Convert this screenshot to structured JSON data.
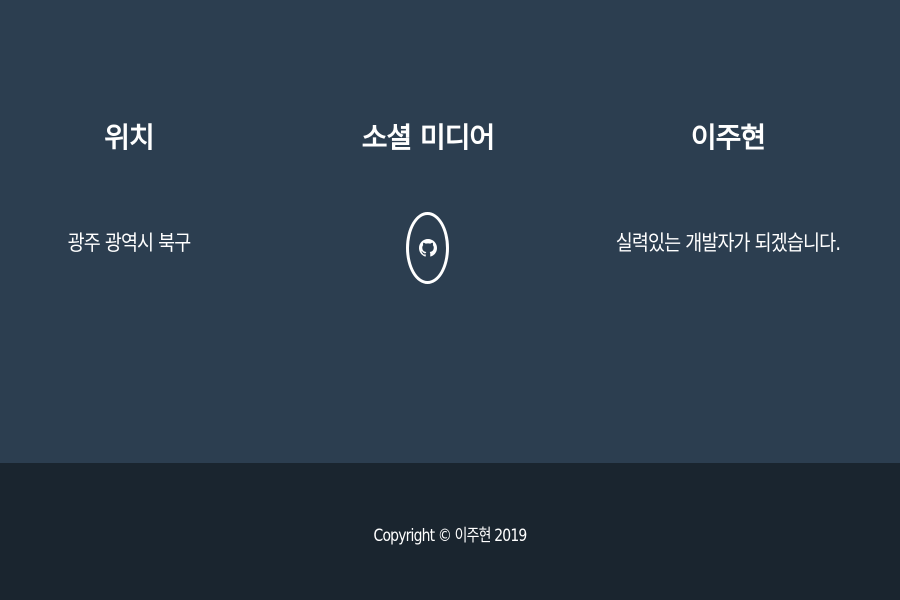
{
  "sections": {
    "location": {
      "heading": "위치",
      "text": "광주 광역시 북구"
    },
    "social": {
      "heading": "소셜 미디어",
      "icons": [
        "github-icon"
      ]
    },
    "about": {
      "heading": "이주현",
      "text": "실력있는 개발자가 되겠습니다."
    }
  },
  "copyright": {
    "text": "Copyright © 이주현 2019"
  },
  "colors": {
    "footer_bg": "#2c3e50",
    "copyright_bg": "#1a252f",
    "text": "#ffffff"
  }
}
